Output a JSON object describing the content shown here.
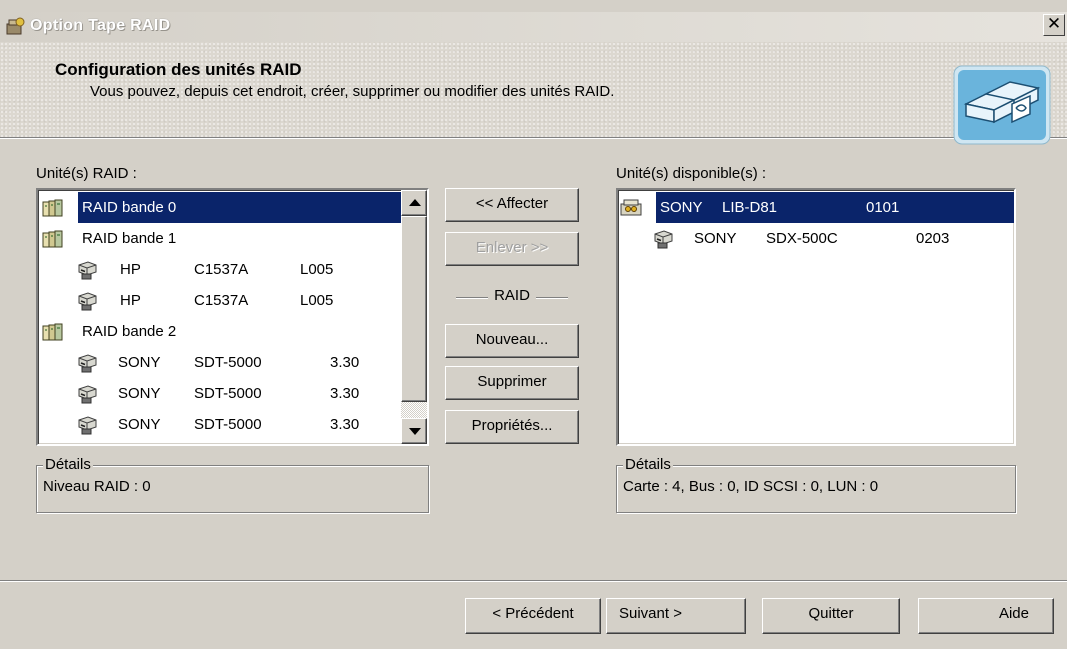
{
  "window": {
    "title": "Option Tape RAID",
    "close_label": "✕"
  },
  "header": {
    "title": "Configuration des unités RAID",
    "subtitle": "Vous pouvez, depuis cet endroit, créer, supprimer ou modifier des unités RAID."
  },
  "raid_panel": {
    "label": "Unité(s) RAID :",
    "items": [
      {
        "type": "raid",
        "name": "RAID bande 0",
        "selected": true
      },
      {
        "type": "raid",
        "name": "RAID bande 1"
      },
      {
        "type": "drive",
        "vendor": "HP",
        "model": "C1537A",
        "rev": "L005"
      },
      {
        "type": "drive",
        "vendor": "HP",
        "model": "C1537A",
        "rev": "L005"
      },
      {
        "type": "raid",
        "name": "RAID bande 2"
      },
      {
        "type": "drive",
        "vendor": "SONY",
        "model": "SDT-5000",
        "rev": "3.30"
      },
      {
        "type": "drive",
        "vendor": "SONY",
        "model": "SDT-5000",
        "rev": "3.30"
      },
      {
        "type": "drive",
        "vendor": "SONY",
        "model": "SDT-5000",
        "rev": "3.30"
      }
    ],
    "details_label": "Détails",
    "details_value": "Niveau RAID : 0"
  },
  "middle_buttons": {
    "assign": "<< Affecter",
    "remove": "Enlever >>",
    "raid_section": "RAID",
    "new": "Nouveau...",
    "delete": "Supprimer",
    "properties": "Propriétés..."
  },
  "available_panel": {
    "label": "Unité(s) disponible(s) :",
    "items": [
      {
        "type": "library",
        "vendor": "SONY",
        "model": "LIB-D81",
        "rev": "0101",
        "selected": true
      },
      {
        "type": "drive",
        "vendor": "SONY",
        "model": "SDX-500C",
        "rev": "0203"
      }
    ],
    "details_label": "Détails",
    "details_value": "Carte : 4, Bus : 0, ID SCSI : 0, LUN : 0"
  },
  "footer": {
    "previous": "< Précédent",
    "next": "Suivant >",
    "quit": "Quitter",
    "help": "Aide"
  },
  "colors": {
    "selection": "#0a246a",
    "face": "#d4d0c8"
  }
}
